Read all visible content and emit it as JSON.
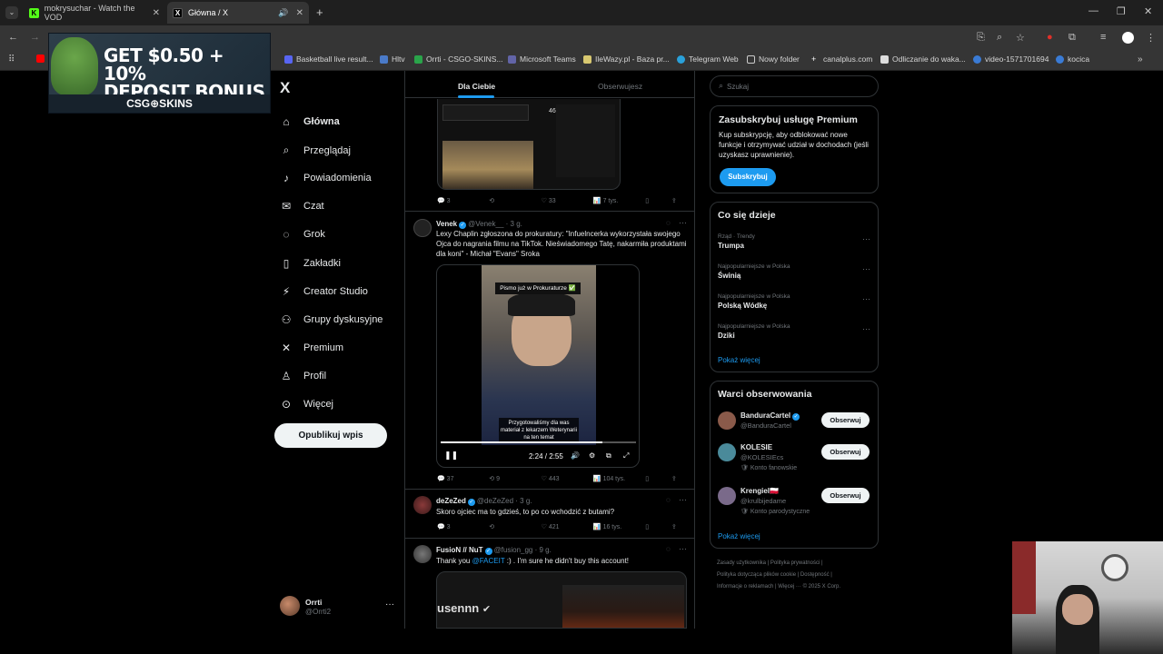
{
  "browser": {
    "tabs": [
      {
        "title": "mokrysuchar - Watch the VOD",
        "active": false
      },
      {
        "title": "Główna / X",
        "active": true
      }
    ],
    "bookmarks": [
      "Basketball live result...",
      "Hltv",
      "Orrti - CSGO-SKINS...",
      "Microsoft Teams",
      "IleWazy.pl - Baza pr...",
      "Telegram Web",
      "Nowy folder",
      "canalplus.com",
      "Odliczanie do waka...",
      "video-1571701694",
      "kocica"
    ]
  },
  "ad": {
    "headline_1": "GET $0.50 + 10%",
    "headline_2": "DEPOSIT BONUS",
    "brand": "CSG⊕SKINS"
  },
  "sidebar": {
    "logo": "X",
    "items": [
      {
        "label": "Główna",
        "icon": "home-icon",
        "glyph": "⌂"
      },
      {
        "label": "Przeglądaj",
        "icon": "search-icon",
        "glyph": "⌕"
      },
      {
        "label": "Powiadomienia",
        "icon": "bell-icon",
        "glyph": "♪"
      },
      {
        "label": "Czat",
        "icon": "mail-icon",
        "glyph": "✉"
      },
      {
        "label": "Grok",
        "icon": "grok-icon",
        "glyph": "◌"
      },
      {
        "label": "Zakładki",
        "icon": "bookmark-icon",
        "glyph": "▯"
      },
      {
        "label": "Creator Studio",
        "icon": "lightning-icon",
        "glyph": "⚡"
      },
      {
        "label": "Grupy dyskusyjne",
        "icon": "people-icon",
        "glyph": "⚇"
      },
      {
        "label": "Premium",
        "icon": "x-logo-icon",
        "glyph": "✕"
      },
      {
        "label": "Profil",
        "icon": "person-icon",
        "glyph": "♙"
      },
      {
        "label": "Więcej",
        "icon": "more-circle-icon",
        "glyph": "⊙"
      }
    ],
    "post_button": "Opublikuj wpis",
    "account": {
      "name": "Orrti",
      "handle": "@Orrti2"
    }
  },
  "feed": {
    "tabs": [
      "Dla Ciebie",
      "Obserwujesz"
    ],
    "tweet0_actions": {
      "replies": "3",
      "likes": "33",
      "views": "7 tys."
    },
    "tweet1": {
      "name": "Venek",
      "handle": "@Venek__",
      "time": "· 3 g.",
      "text": "Lexy Chaplin zgłoszona do prokuratury: \"Infuelncerka wykorzystała swojego Ojca do nagrania filmu na TikTok. Nieświadomego Tatę, nakarmiła produktami dla koni\" - Michał \"Evans\" Sroka",
      "video_caption_top": "Pismo już w Prokuraturze ✅",
      "video_subtitle": "Przygotowaliśmy dla was materiał z lekarzem Weterynarii na ten temat",
      "video_time": "2:24 / 2:55",
      "video_progress": 0.826,
      "replies": "37",
      "retweets": "9",
      "likes": "443",
      "views": "104 tys."
    },
    "tweet2": {
      "name": "deZeZed",
      "handle": "@deZeZed",
      "time": "· 3 g.",
      "text": "Skoro ojciec ma to gdzieś, to po co wchodzić z butami?",
      "replies": "3",
      "likes": "421",
      "views": "16 tys."
    },
    "tweet3": {
      "name": "FusioN // NuT",
      "handle": "@fusion_gg",
      "time": "· 9 g.",
      "text_mention": "@FACEIT",
      "text_prefix": "Thank you ",
      "text_suffix": " :) . I'm sure he didn't buy this account!",
      "image_text": "usennn"
    }
  },
  "right": {
    "search_placeholder": "Szukaj",
    "premium": {
      "title": "Zasubskrybuj usługę Premium",
      "text": "Kup subskrypcję, aby odblokować nowe funkcje i otrzymywać udział w dochodach (jeśli uzyskasz uprawnienie).",
      "button": "Subskrybuj"
    },
    "trends_title": "Co się dzieje",
    "trends": [
      {
        "context": "Rząd · Trendy",
        "name": "Trumpa"
      },
      {
        "context": "Najpopularniejsze w Polska",
        "name": "Świnią"
      },
      {
        "context": "Najpopularniejsze w Polska",
        "name": "Polską Wódkę"
      },
      {
        "context": "Najpopularniejsze w Polska",
        "name": "Dziki"
      }
    ],
    "show_more": "Pokaż więcej",
    "who_title": "Warci obserwowania",
    "who": [
      {
        "name": "BanduraCartel",
        "handle": "@BanduraCartel",
        "sub": "",
        "color": "#8a5a4a"
      },
      {
        "name": "KOLESIE",
        "handle": "@KOLESIEcs",
        "sub": "🛡 Konto fanowskie",
        "color": "#4a8a9a"
      },
      {
        "name": "Krengiel🇵🇱",
        "handle": "@krulbijedame",
        "sub": "🛡 Konto parodystyczne",
        "color": "#7a6a8a"
      }
    ],
    "follow_label": "Obserwuj",
    "footer_1": "Zasady użytkownika | Polityka prywatności |",
    "footer_2": "Polityka dotycząca plików cookie | Dostępność |",
    "footer_3": "Informacje o reklamach | Więcej ··· © 2025 X Corp."
  }
}
